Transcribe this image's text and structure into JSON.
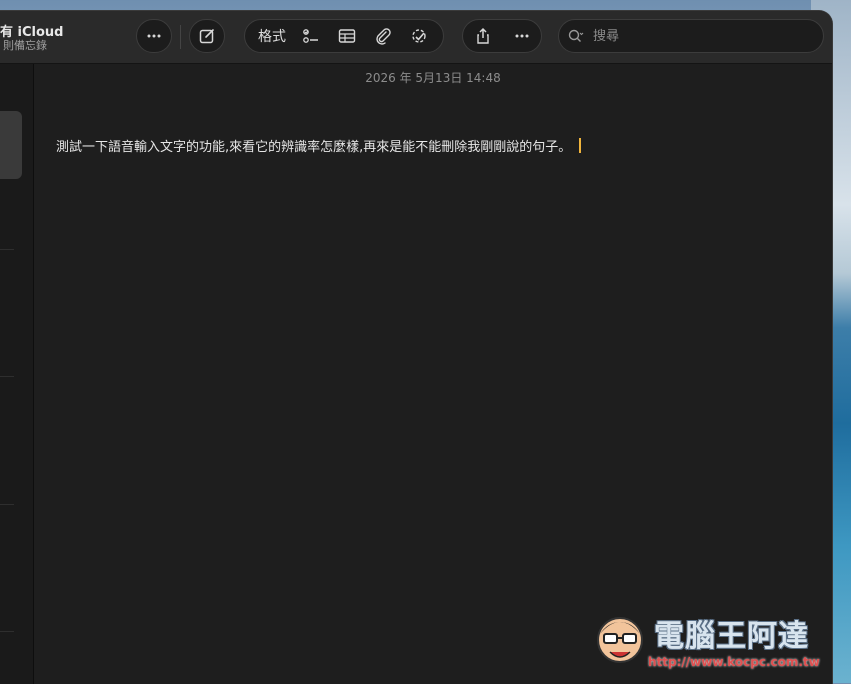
{
  "account": {
    "title": "有 iCloud",
    "subtitle": "則備忘錄"
  },
  "toolbar": {
    "more_left": "more-icon",
    "compose": "compose-icon",
    "format_label": "格式",
    "checklist": "checklist-icon",
    "table": "table-icon",
    "attach": "paperclip-icon",
    "collab": "collaborate-icon",
    "share": "share-icon",
    "more_right": "more-icon"
  },
  "search": {
    "placeholder": "搜尋"
  },
  "note": {
    "date": "2026 年 5月13日 14:48",
    "text": "測試一下語音輸入文字的功能,來看它的辨識率怎麼樣,再來是能不能刪除我剛剛說的句子。"
  },
  "watermark": {
    "text": "電腦王阿達",
    "url": "http://www.kocpc.com.tw"
  },
  "colors": {
    "caret": "#f0b43c",
    "window_bg": "#1e1e1e"
  }
}
